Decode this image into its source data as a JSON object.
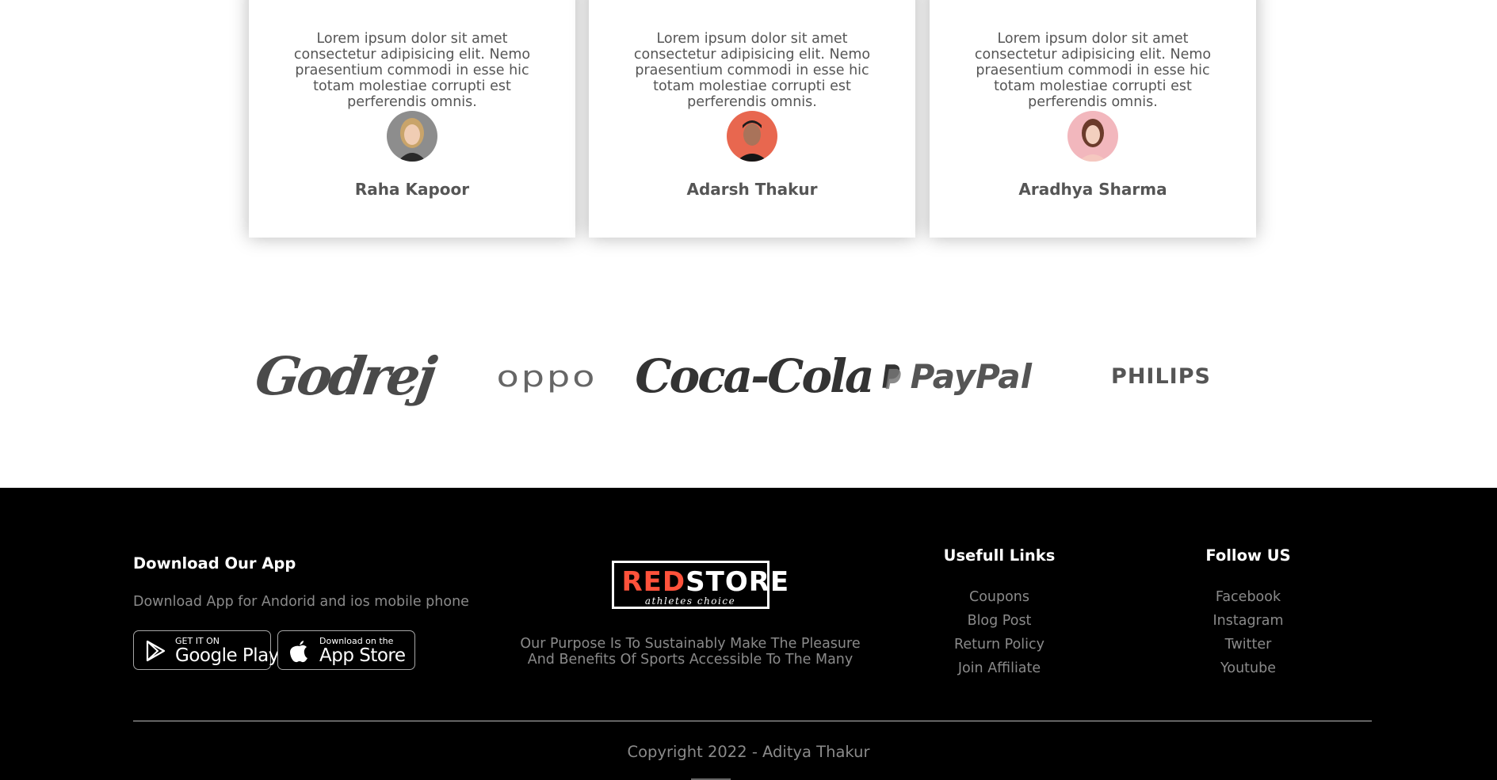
{
  "testimonials": [
    {
      "quote": "Lorem ipsum dolor sit amet consectetur adipisicing elit. Nemo praesentium commodi in esse hic totam molestiae corrupti est perferendis omnis.",
      "name": "Raha Kapoor"
    },
    {
      "quote": "Lorem ipsum dolor sit amet consectetur adipisicing elit. Nemo praesentium commodi in esse hic totam molestiae corrupti est perferendis omnis.",
      "name": "Adarsh Thakur"
    },
    {
      "quote": "Lorem ipsum dolor sit amet consectetur adipisicing elit. Nemo praesentium commodi in esse hic totam molestiae corrupti est perferendis omnis.",
      "name": "Aradhya Sharma"
    }
  ],
  "brands": {
    "godrej": "Godrej",
    "oppo": "oppo",
    "coca_cola": "Coca-Cola",
    "paypal": "PayPal",
    "philips": "PHILIPS"
  },
  "footer": {
    "app": {
      "title": "Download Our App",
      "subtitle": "Download App for Andorid and ios mobile phone",
      "google_play_small": "GET IT ON",
      "google_play_big": "Google Play",
      "app_store_small": "Download on the",
      "app_store_big": "App Store"
    },
    "logo": {
      "red": "RED",
      "white": "STORE",
      "tagline": "athletes choice"
    },
    "purpose": "Our Purpose Is To Sustainably Make The Pleasure And Benefits Of Sports Accessible To The Many",
    "useful_links": {
      "title": "Usefull Links",
      "items": [
        "Coupons",
        "Blog Post",
        "Return Policy",
        "Join Affiliate"
      ]
    },
    "follow": {
      "title": "Follow US",
      "items": [
        "Facebook",
        "Instagram",
        "Twitter",
        "Youtube"
      ]
    },
    "copyright": "Copyright 2022 - Aditya Thakur"
  },
  "colors": {
    "accent": "#ff523b",
    "footer_bg": "#000000",
    "footer_text": "#8a8a8a"
  }
}
